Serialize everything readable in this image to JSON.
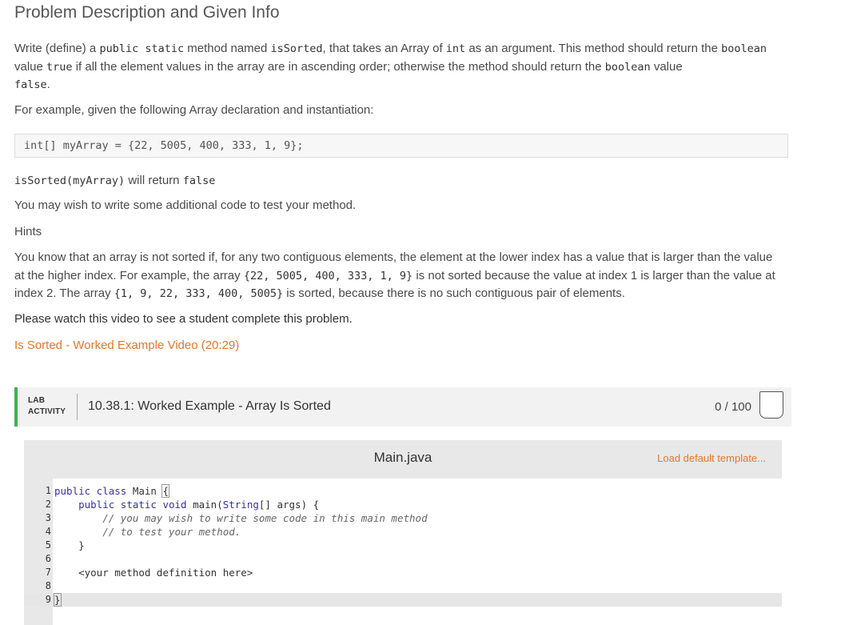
{
  "title": "Problem Description and Given Info",
  "intro": {
    "t1": "Write (define) a ",
    "c1": "public static",
    "t2": " method named ",
    "c2": "isSorted",
    "t3": ", that takes an Array of ",
    "c3": "int",
    "t4": " as an argument. This method should return the ",
    "c4": "boolean",
    "t5": " value ",
    "c5": "true",
    "t6": " if all the element values in the array are in ascending order; otherwise the method should return the ",
    "c6": "boolean",
    "t7": " value ",
    "c7": "false",
    "t8": "."
  },
  "example_intro": "For example, given the following Array declaration and instantiation:",
  "example_code": "int[] myArray = {22, 5005, 400, 333, 1, 9};",
  "return_line": {
    "c1": "isSorted(myArray)",
    "t1": " will return ",
    "c2": "false"
  },
  "additional": "You may wish to write some additional code to test your method.",
  "hints_heading": "Hints",
  "hint": {
    "t1": "You know that an array is not sorted if, for any two contiguous elements, the element at the lower index has a value that is larger than the value at the higher index. For example, the array ",
    "c1": "{22, 5005, 400, 333, 1, 9}",
    "t2": " is not sorted because the value at index 1 is larger than the value at index 2. The array ",
    "c2": "{1, 9, 22, 333, 400, 5005}",
    "t3": " is sorted, because there is no such contiguous pair of elements."
  },
  "video_prompt": "Please watch this video to see a student complete this problem.",
  "video_link": "Is Sorted - Worked Example Video (20:29)",
  "lab": {
    "badge_line1": "LAB",
    "badge_line2": "ACTIVITY",
    "title": "10.38.1: Worked Example - Array Is Sorted",
    "score": "0 / 100"
  },
  "editor": {
    "file_name": "Main.java",
    "load_template": "Load default template...",
    "lines": [
      {
        "n": "1"
      },
      {
        "n": "2"
      },
      {
        "n": "3"
      },
      {
        "n": "4"
      },
      {
        "n": "5"
      },
      {
        "n": "6"
      },
      {
        "n": "7"
      },
      {
        "n": "8"
      },
      {
        "n": "9"
      }
    ],
    "code": {
      "l1_kw": "public class",
      "l1_rest": " Main ",
      "l1_brace": "{",
      "l2_indent": "    ",
      "l2_kw": "public static void",
      "l2_rest": " main(",
      "l2_type": "String",
      "l2_rest2": "[] args) {",
      "l3": "        // you may wish to write some code in this main method",
      "l4": "        // to test your method.",
      "l5": "    }",
      "l7": "    <your method definition here>",
      "l9": "}"
    }
  }
}
